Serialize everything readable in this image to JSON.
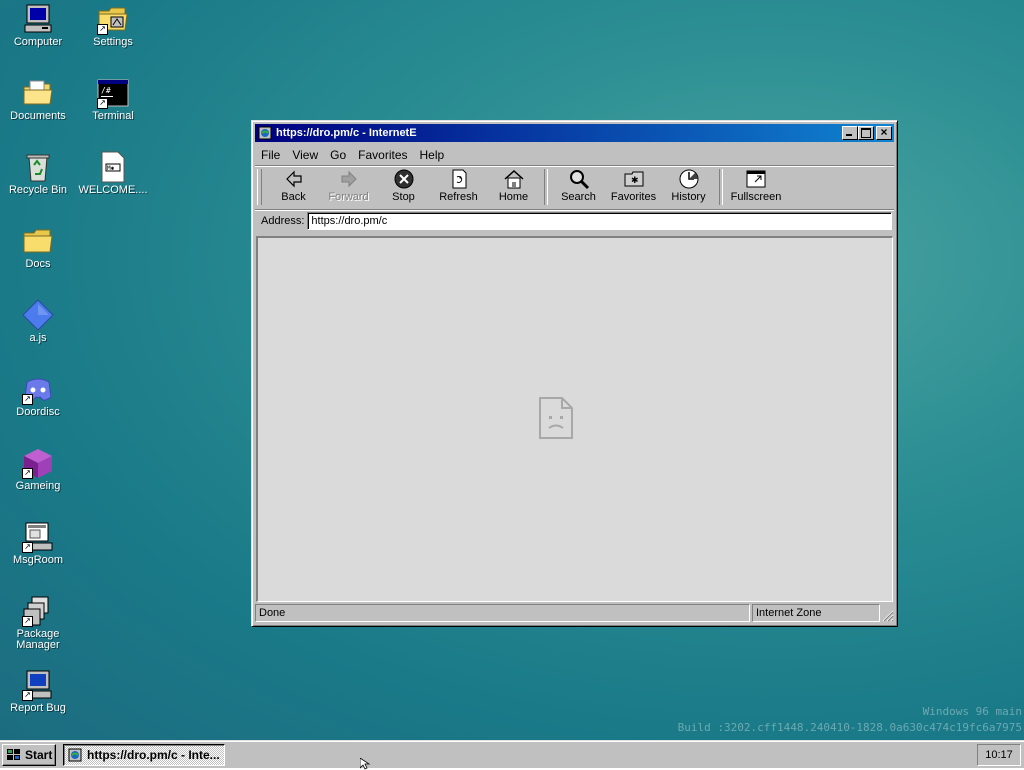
{
  "desktop": {
    "icons": [
      {
        "label": "Computer",
        "icon": "computer-icon"
      },
      {
        "label": "Settings",
        "icon": "settings-icon"
      },
      {
        "label": "Documents",
        "icon": "documents-folder-icon"
      },
      {
        "label": "Terminal",
        "icon": "terminal-icon"
      },
      {
        "label": "Recycle Bin",
        "icon": "recycle-bin-icon"
      },
      {
        "label": "WELCOME....",
        "icon": "text-document-icon"
      },
      {
        "label": "Docs",
        "icon": "folder-icon"
      },
      {
        "label": "a.js",
        "icon": "javascript-file-icon"
      },
      {
        "label": "Doordisc",
        "icon": "discord-icon"
      },
      {
        "label": "Gameing",
        "icon": "cube-game-icon"
      },
      {
        "label": "MsgRoom",
        "icon": "msgroom-icon"
      },
      {
        "label": "Package Manager",
        "icon": "package-manager-icon"
      },
      {
        "label": "Report Bug",
        "icon": "report-bug-icon"
      }
    ],
    "watermark_line1": "Windows 96 main",
    "watermark_line2": "Build :3202.cff1448.240410-1828.0a630c474c19fc6a7975"
  },
  "window": {
    "title": "https://dro.pm/c - InternetE",
    "controls": {
      "minimize": "_",
      "maximize": "□",
      "close": "×"
    },
    "menu": [
      "File",
      "View",
      "Go",
      "Favorites",
      "Help"
    ],
    "toolbar": {
      "back": "Back",
      "forward": "Forward",
      "stop": "Stop",
      "refresh": "Refresh",
      "home": "Home",
      "search": "Search",
      "favorites": "Favorites",
      "history": "History",
      "fullscreen": "Fullscreen"
    },
    "address_label": "Address:",
    "address_value": "https://dro.pm/c",
    "status_text": "Done",
    "status_zone": "Internet Zone"
  },
  "taskbar": {
    "start_label": "Start",
    "task_label": "https://dro.pm/c - Inte...",
    "clock": "10:17"
  },
  "colors": {
    "title_gradient_start": "#000080",
    "title_gradient_end": "#1084d0",
    "face": "#c0c0c0",
    "desktop": "#2b8e93"
  }
}
